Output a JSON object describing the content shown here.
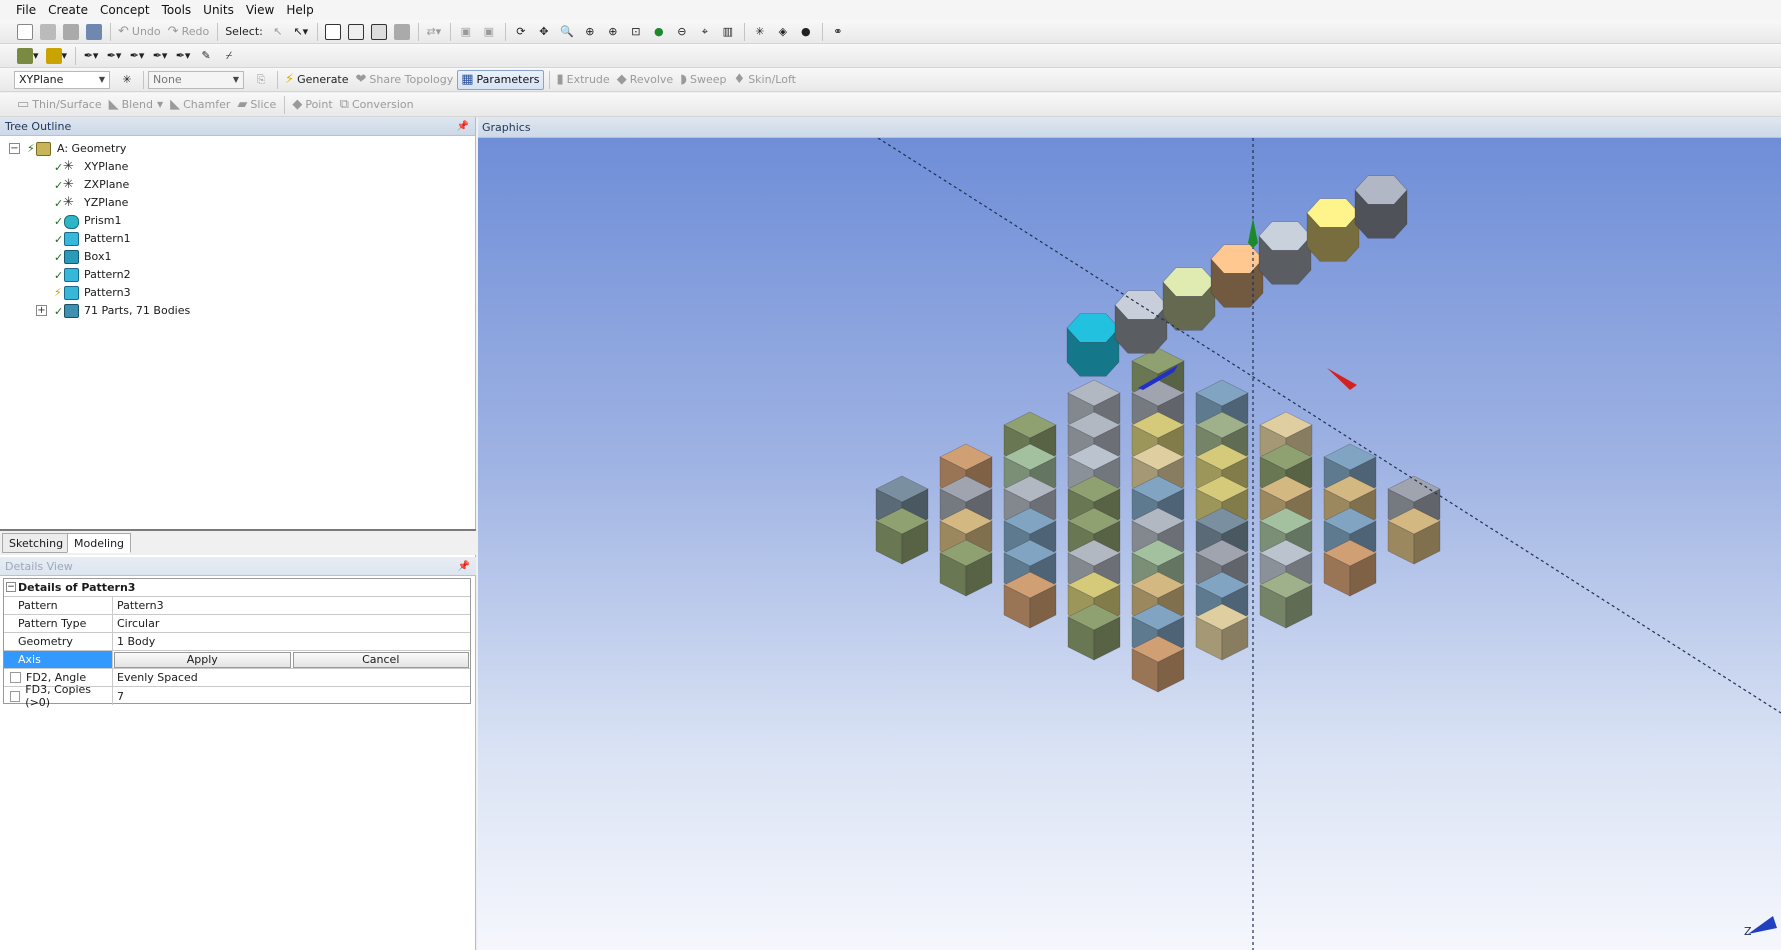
{
  "menu": [
    "File",
    "Create",
    "Concept",
    "Tools",
    "Units",
    "View",
    "Help"
  ],
  "toolbar1": {
    "undo_label": "Undo",
    "redo_label": "Redo",
    "select_label": "Select:"
  },
  "toolbar3": {
    "plane_value": "XYPlane",
    "sketch_value": "None",
    "generate_label": "Generate",
    "share_topology_label": "Share Topology",
    "parameters_label": "Parameters",
    "extrude_label": "Extrude",
    "revolve_label": "Revolve",
    "sweep_label": "Sweep",
    "skin_loft_label": "Skin/Loft"
  },
  "toolbar4": {
    "thin_surface_label": "Thin/Surface",
    "blend_label": "Blend",
    "chamfer_label": "Chamfer",
    "slice_label": "Slice",
    "point_label": "Point",
    "conversion_label": "Conversion"
  },
  "tree_outline": {
    "title": "Tree Outline",
    "root": "A: Geometry",
    "items": [
      {
        "label": "XYPlane",
        "icon": "plane-icon"
      },
      {
        "label": "ZXPlane",
        "icon": "plane-icon"
      },
      {
        "label": "YZPlane",
        "icon": "plane-icon"
      },
      {
        "label": "Prism1",
        "icon": "prism-icon"
      },
      {
        "label": "Pattern1",
        "icon": "pattern-icon"
      },
      {
        "label": "Box1",
        "icon": "box-icon"
      },
      {
        "label": "Pattern2",
        "icon": "pattern-icon"
      },
      {
        "label": "Pattern3",
        "icon": "pattern-icon"
      },
      {
        "label": "71 Parts, 71 Bodies",
        "icon": "parts-icon"
      }
    ]
  },
  "tabs": {
    "sketching": "Sketching",
    "modeling": "Modeling"
  },
  "details": {
    "title": "Details View",
    "heading": "Details of Pattern3",
    "rows": {
      "pattern_key": "Pattern",
      "pattern_val": "Pattern3",
      "type_key": "Pattern Type",
      "type_val": "Circular",
      "geometry_key": "Geometry",
      "geometry_val": "1 Body",
      "axis_key": "Axis",
      "apply_label": "Apply",
      "cancel_label": "Cancel",
      "angle_key": "FD2, Angle",
      "angle_val": "Evenly Spaced",
      "copies_key": "FD3, Copies (>0)",
      "copies_val": "7"
    }
  },
  "graphics": {
    "title": "Graphics",
    "triad_label": "Z"
  },
  "colors": {
    "panel_title": "#cdd9e8",
    "selection": "#3399ff",
    "highlight_body": "#1fb8d4",
    "axis_green": "#1a8a2a",
    "axis_red": "#d42020",
    "axis_blue": "#2030c8"
  }
}
